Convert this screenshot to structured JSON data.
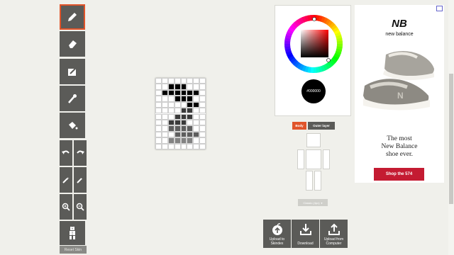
{
  "tools": {
    "pencil": "pencil-icon",
    "eraser": "eraser-icon",
    "noise": "noise-icon",
    "eyedropper": "eyedropper-icon",
    "bucket": "bucket-icon",
    "undo": "undo-icon",
    "redo": "redo-icon",
    "darken": "darken-icon",
    "lighten": "lighten-icon",
    "zoom_in": "zoom-in-icon",
    "zoom_out": "zoom-out-icon",
    "mirror": "mirror-icon",
    "reset_label": "Reset Skin"
  },
  "color": {
    "hex": "#000000",
    "selected": "#000000"
  },
  "tabs": {
    "body": "Body",
    "outer": "Outer layer",
    "body_color": "#e0542a",
    "outer_color": "#5b5b58"
  },
  "model_select": "Classic (4px)",
  "actions": [
    {
      "label": "Upload to Skindex"
    },
    {
      "label": "Download"
    },
    {
      "label": "Upload from Computer"
    }
  ],
  "ad": {
    "brand": "new balance",
    "headline": [
      "The most",
      "New Balance",
      "shoe ever."
    ],
    "cta": "Shop the 574",
    "cta_color": "#c41b32"
  },
  "canvas": {
    "cols": 8,
    "rows": 12,
    "pixels": [
      "wwwwwwww",
      "wwKKKwww",
      "wKKKKKKw",
      "wwwKKKww",
      "wwwwwKKw",
      "wwwwddww",
      "wwwdddww",
      "wwdddwww",
      "wwmmmmww",
      "wwwmmmmw",
      "wwllllww",
      "wwwwwwww"
    ],
    "palette": {
      "w": "#ffffff",
      "K": "#000000",
      "d": "#3a3a3a",
      "m": "#5e5e5e",
      "l": "#828282"
    }
  }
}
